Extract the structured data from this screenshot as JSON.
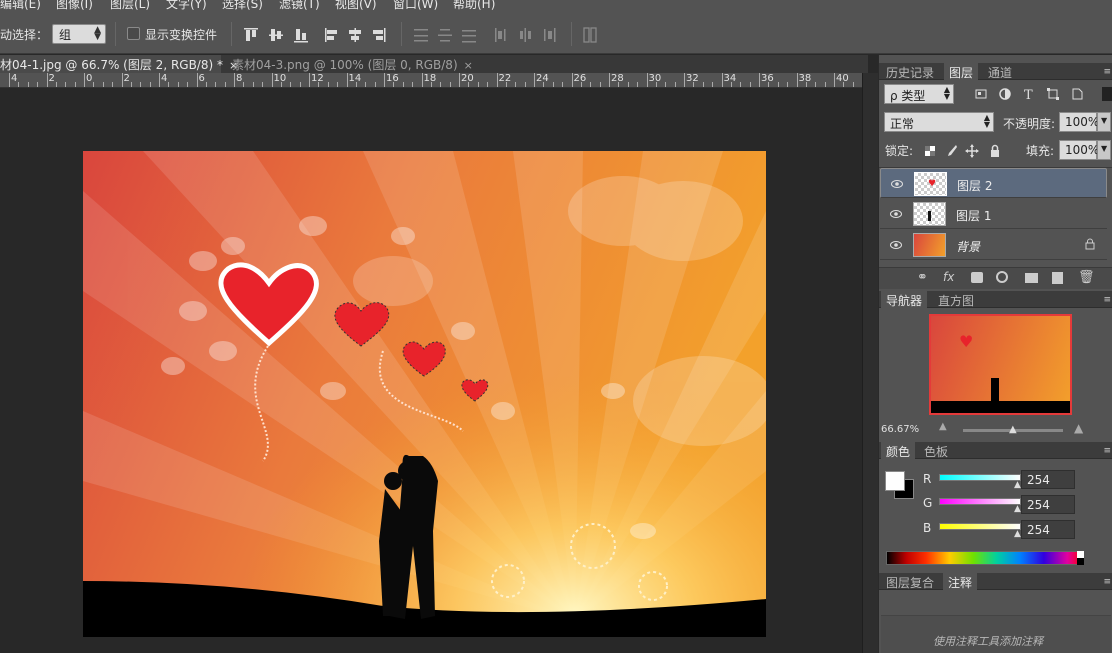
{
  "menu": [
    "编辑(E)",
    "图像(I)",
    "图层(L)",
    "文字(Y)",
    "选择(S)",
    "滤镜(T)",
    "视图(V)",
    "窗口(W)",
    "帮助(H)"
  ],
  "options": {
    "auto_select_label": "动选择：",
    "auto_select_value": "组",
    "show_transform_label": "显示变换控件"
  },
  "tabs": [
    {
      "label": "材04-1.jpg @ 66.7% (图层 2, RGB/8) *",
      "close": "×"
    },
    {
      "label": "素材04-3.png @ 100% (图层 0, RGB/8)",
      "close": "×"
    }
  ],
  "ruler": [
    "4",
    "2",
    "0",
    "2",
    "4",
    "6",
    "8",
    "10",
    "12",
    "14",
    "16",
    "18",
    "20",
    "22",
    "24",
    "26",
    "28",
    "30",
    "32",
    "34",
    "36",
    "38",
    "40"
  ],
  "history_layers_tabs": [
    "历史记录",
    "图层",
    "通道"
  ],
  "layers_panel": {
    "filter_label": "ρ 类型",
    "blend_mode": "正常",
    "opacity_label": "不透明度:",
    "opacity_value": "100%",
    "lock_label": "锁定:",
    "fill_label": "填充:",
    "fill_value": "100%",
    "layers": [
      {
        "name": "图层 2",
        "selected": true
      },
      {
        "name": "图层 1",
        "selected": false
      },
      {
        "name": "背景",
        "selected": false,
        "locked": true
      }
    ]
  },
  "navigator": {
    "tabs": [
      "导航器",
      "直方图"
    ],
    "zoom": "66.67%"
  },
  "color_panel": {
    "tabs": [
      "颜色",
      "色板"
    ],
    "channels": [
      {
        "label": "R",
        "value": "254"
      },
      {
        "label": "G",
        "value": "254"
      },
      {
        "label": "B",
        "value": "254"
      }
    ]
  },
  "notes_panel": {
    "tabs": [
      "图层复合",
      "注释"
    ],
    "hint": "使用注释工具添加注释"
  }
}
